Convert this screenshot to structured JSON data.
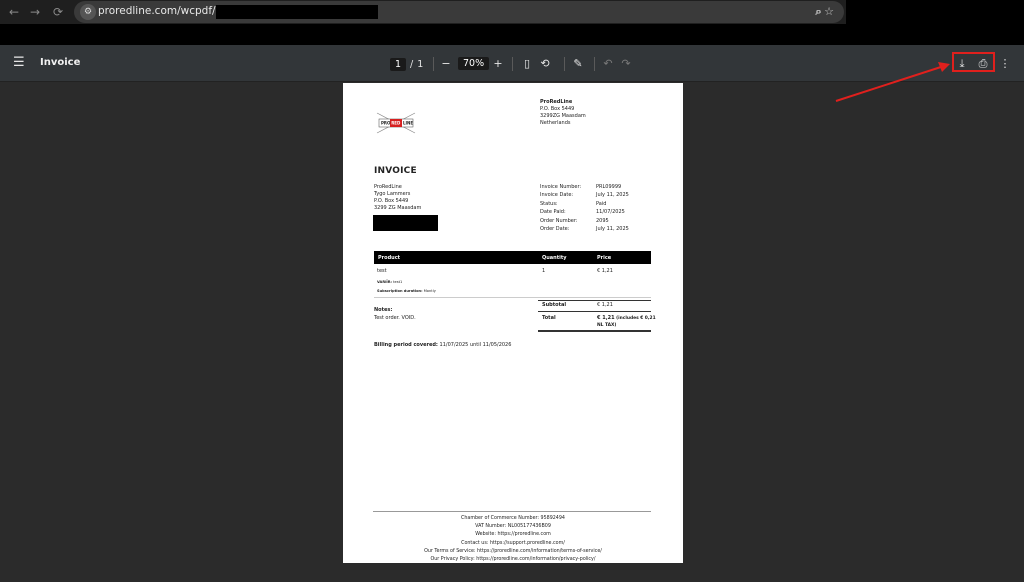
{
  "browser": {
    "url_prefix": "proredline.com/wcpdf/invoice/"
  },
  "toolbar": {
    "title": "Invoice",
    "current_page": "1",
    "page_sep": "/",
    "total_pages": "1",
    "zoom": "70%"
  },
  "invoice": {
    "company": {
      "name": "ProRedLine",
      "lines": [
        "P.O. Box 5449",
        "3299ZG Maasdam",
        "Netherlands"
      ]
    },
    "logo_text": {
      "left": "PRO",
      "mid": "RED",
      "right": "LINE"
    },
    "title": "INVOICE",
    "customer": [
      "ProRedLine",
      "Tygo Lammers",
      "P.O. Box 5449",
      "3299 ZG Maasdam"
    ],
    "meta": [
      {
        "label": "Invoice Number:",
        "value": "PRL09999"
      },
      {
        "label": "Invoice Date:",
        "value": "July 11, 2025"
      },
      {
        "label": "Status:",
        "value": "Paid"
      },
      {
        "label": "Date Paid:",
        "value": "11/07/2025"
      },
      {
        "label": "Order Number:",
        "value": "2095"
      },
      {
        "label": "Order Date:",
        "value": "July 11, 2025"
      }
    ],
    "table": {
      "headers": {
        "product": "Product",
        "quantity": "Quantity",
        "price": "Price"
      },
      "row": {
        "product": "test",
        "quantity": "1",
        "price": "€ 1,21",
        "variant_label": "VARIÏR:",
        "variant_value": "test1",
        "duration_label": "Subscription duration:",
        "duration_value": "Montly"
      }
    },
    "totals": {
      "subtotal_label": "Subtotal",
      "subtotal_value": "€ 1,21",
      "total_label": "Total",
      "total_value": "€ 1,21",
      "total_tax_note": "(includes € 0,21",
      "total_tax_note2": "NL TAX)"
    },
    "notes": {
      "label": "Notes:",
      "text": "Test order. VOID."
    },
    "billing": {
      "label": "Billing period covered:",
      "text": "11/07/2025 until 11/05/2026"
    },
    "footer": [
      "Chamber of Commerce Number: 95892494",
      "VAT Number: NL005177436B09",
      "Website: https://proredline.com",
      "Contact us: https://support.proredline.com/",
      "Our Terms of Service: https://proredline.com/information/terms-of-service/",
      "Our Privacy Policy: https://proredline.com/information/privacy-policy/"
    ]
  },
  "colors": {
    "toolbar_bg": "#323639",
    "viewer_bg": "#2b2b2b",
    "highlight": "#e0201d"
  },
  "icons": [
    "back-icon",
    "forward-icon",
    "reload-icon",
    "site-info-icon",
    "zoom-icon",
    "star-icon",
    "menu-icon",
    "zoom-out-icon",
    "zoom-in-icon",
    "fit-page-icon",
    "rotate-icon",
    "annotate-icon",
    "undo-icon",
    "redo-icon",
    "download-icon",
    "print-icon",
    "more-icon"
  ]
}
